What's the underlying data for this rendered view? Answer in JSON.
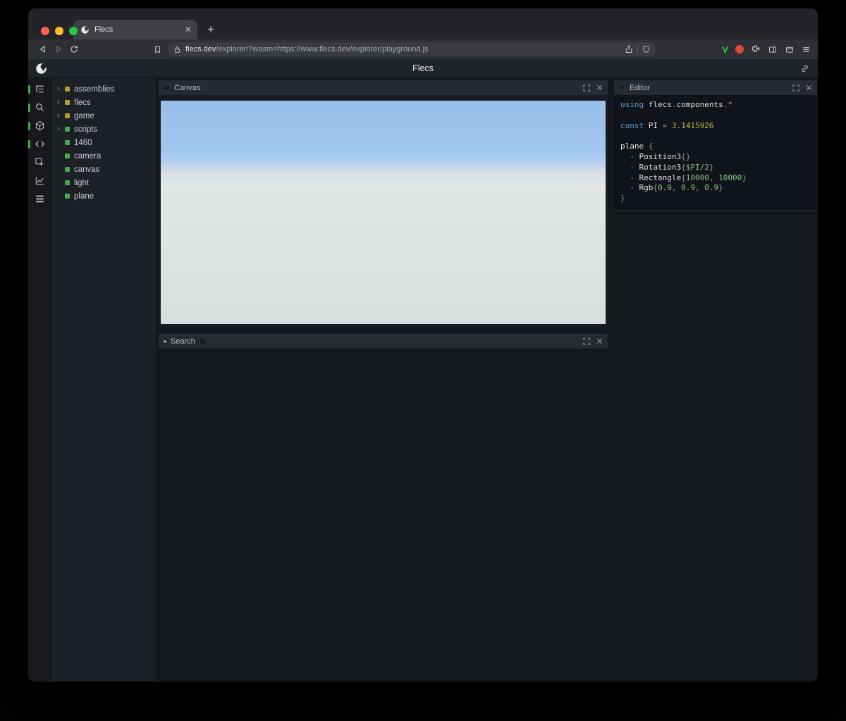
{
  "browser": {
    "tab": {
      "title": "Flecs"
    },
    "new_tab_label": "+",
    "url": {
      "domain": "flecs.dev",
      "rest": "/explorer/?wasm=https://www.flecs.dev/explorer/playground.js"
    }
  },
  "app": {
    "title": "Flecs",
    "sidebar": [
      {
        "name": "tree-icon",
        "active": true
      },
      {
        "name": "search-icon",
        "active": true
      },
      {
        "name": "entities-icon",
        "active": true
      },
      {
        "name": "code-icon",
        "active": true
      },
      {
        "name": "inspect-icon",
        "active": false
      },
      {
        "name": "stats-icon",
        "active": false
      },
      {
        "name": "rows-icon",
        "active": false
      }
    ],
    "tree": {
      "items": [
        {
          "label": "assemblies",
          "color": "#b99b26",
          "expandable": true
        },
        {
          "label": "flecs",
          "color": "#b99b26",
          "expandable": true
        },
        {
          "label": "game",
          "color": "#b99b26",
          "expandable": true
        },
        {
          "label": "scripts",
          "color": "#44ad4c",
          "expandable": true
        },
        {
          "label": "1460",
          "color": "#44ad4c",
          "expandable": false
        },
        {
          "label": "camera",
          "color": "#44ad4c",
          "expandable": false
        },
        {
          "label": "canvas",
          "color": "#44ad4c",
          "expandable": false
        },
        {
          "label": "light",
          "color": "#44ad4c",
          "expandable": false
        },
        {
          "label": "plane",
          "color": "#44ad4c",
          "expandable": false
        }
      ]
    },
    "panels": {
      "canvas": {
        "title": "Canvas"
      },
      "search": {
        "title": "Search"
      },
      "editor": {
        "title": "Editor"
      }
    },
    "editor": {
      "lines": [
        [
          {
            "c": "kw",
            "t": "using "
          },
          {
            "c": "pl",
            "t": "flecs"
          },
          {
            "c": "pu",
            "t": "."
          },
          {
            "c": "pl",
            "t": "components"
          },
          {
            "c": "pu",
            "t": "."
          },
          {
            "c": "op",
            "t": "*"
          }
        ],
        [],
        [
          {
            "c": "kw",
            "t": "const "
          },
          {
            "c": "pl",
            "t": "PI "
          },
          {
            "c": "pu",
            "t": "= "
          },
          {
            "c": "num",
            "t": "3.1415926"
          }
        ],
        [],
        [
          {
            "c": "pl",
            "t": "plane "
          },
          {
            "c": "pu",
            "t": "{"
          }
        ],
        [
          {
            "c": "pu",
            "t": "  - "
          },
          {
            "c": "pl",
            "t": "Position3"
          },
          {
            "c": "pu",
            "t": "{}"
          }
        ],
        [
          {
            "c": "pu",
            "t": "  - "
          },
          {
            "c": "pl",
            "t": "Rotation3"
          },
          {
            "c": "pu",
            "t": "{"
          },
          {
            "c": "var",
            "t": "$PI/2"
          },
          {
            "c": "pu",
            "t": "}"
          }
        ],
        [
          {
            "c": "pu",
            "t": "  - "
          },
          {
            "c": "pl",
            "t": "Rectangle"
          },
          {
            "c": "pu",
            "t": "{"
          },
          {
            "c": "num2",
            "t": "10000"
          },
          {
            "c": "pu",
            "t": ", "
          },
          {
            "c": "num2",
            "t": "10000"
          },
          {
            "c": "pu",
            "t": "}"
          }
        ],
        [
          {
            "c": "pu",
            "t": "  - "
          },
          {
            "c": "pl",
            "t": "Rgb"
          },
          {
            "c": "pu",
            "t": "{"
          },
          {
            "c": "num2",
            "t": "0.9"
          },
          {
            "c": "pu",
            "t": ", "
          },
          {
            "c": "num2",
            "t": "0.9"
          },
          {
            "c": "pu",
            "t": ", "
          },
          {
            "c": "num2",
            "t": "0.9"
          },
          {
            "c": "pu",
            "t": "}"
          }
        ],
        [
          {
            "c": "pu",
            "t": "}"
          }
        ]
      ]
    },
    "colors": {
      "module_yellow": "#b99b26",
      "entity_green": "#44ad4c",
      "accent_green": "#3fae4a",
      "sky_top": "#98bfeb",
      "ground": "#dde3e3"
    }
  }
}
